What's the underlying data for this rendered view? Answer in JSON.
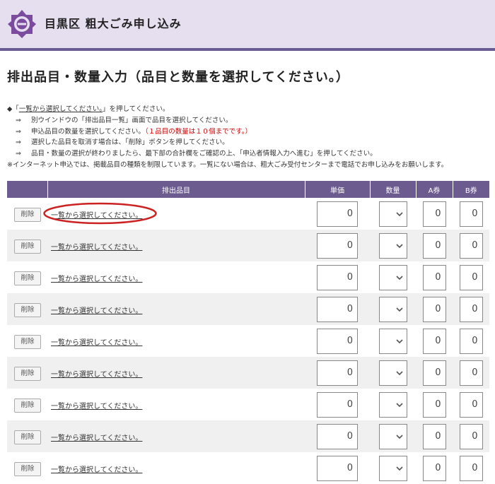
{
  "header": {
    "title": "目黒区 粗大ごみ申し込み",
    "logo_icon": "meguro-ward-emblem-icon",
    "background": "#e5dff0",
    "accent": "#6b5b95"
  },
  "page_heading": "排出品目・数量入力（品目と数量を選択してください。）",
  "instructions": {
    "line1_prefix": "◆「",
    "line1_link": "一覧から選択してください。",
    "line1_suffix": "」を押してください。",
    "arrow": "⇒",
    "line2": "別ウインドウの「排出品目一覧」画面で品目を選択してください。",
    "line3": "申込品目の数量を選択してください。",
    "line3_red": "（１品目の数量は１０個までです。）",
    "line4": "選択した品目を取消す場合は、「削除」ボタンを押してください。",
    "line5": "品目・数量の選択が終わりましたら、最下部の合計欄をご確認の上、「申込者情報入力へ進む」を押してください。",
    "note": "※インターネット申込では、掲載品目の種類を制限しています。一覧にない場合は、粗大ごみ受付センターまで電話でお申し込みをお願いします。"
  },
  "table": {
    "headers": [
      "",
      "排出品目",
      "単価",
      "数量",
      "A券",
      "B券"
    ],
    "delete_label": "削除",
    "select_label": "一覧から選択してください。",
    "rows": [
      {
        "price": "0",
        "a": "0",
        "b": "0"
      },
      {
        "price": "0",
        "a": "0",
        "b": "0"
      },
      {
        "price": "0",
        "a": "0",
        "b": "0"
      },
      {
        "price": "0",
        "a": "0",
        "b": "0"
      },
      {
        "price": "0",
        "a": "0",
        "b": "0"
      },
      {
        "price": "0",
        "a": "0",
        "b": "0"
      },
      {
        "price": "0",
        "a": "0",
        "b": "0"
      },
      {
        "price": "0",
        "a": "0",
        "b": "0"
      },
      {
        "price": "0",
        "a": "0",
        "b": "0"
      }
    ]
  },
  "annotation": {
    "shape": "red-ellipse",
    "color": "#cc2222"
  }
}
